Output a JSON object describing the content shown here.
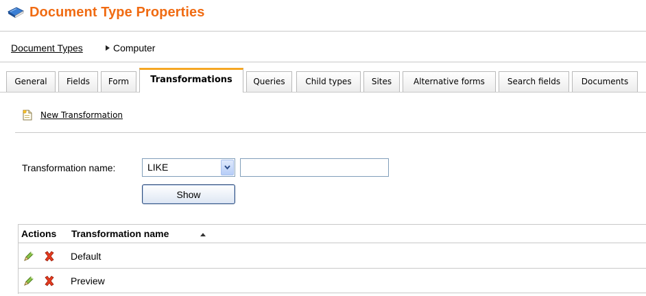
{
  "header": {
    "title": "Document Type Properties",
    "icon": "book-icon",
    "title_color": "#f06b12"
  },
  "breadcrumb": {
    "link": "Document Types",
    "current": "Computer"
  },
  "tabs": [
    {
      "label": "General"
    },
    {
      "label": "Fields"
    },
    {
      "label": "Form"
    },
    {
      "label": "Transformations",
      "active": true
    },
    {
      "label": "Queries"
    },
    {
      "label": "Child types"
    },
    {
      "label": "Sites"
    },
    {
      "label": "Alternative forms"
    },
    {
      "label": "Search fields"
    },
    {
      "label": "Documents"
    }
  ],
  "toolbar": {
    "new_transformation_label": "New Transformation",
    "new_icon": "new-document-icon"
  },
  "filter": {
    "label": "Transformation name:",
    "operator": "LIKE",
    "value": "",
    "show_label": "Show"
  },
  "grid": {
    "columns": [
      "Actions",
      "Transformation name"
    ],
    "sort_column": "Transformation name",
    "sort_direction": "ascending",
    "rows": [
      {
        "name": "Default"
      },
      {
        "name": "Preview"
      }
    ],
    "edit_icon": "edit-pencil-icon",
    "delete_icon": "delete-x-icon"
  }
}
